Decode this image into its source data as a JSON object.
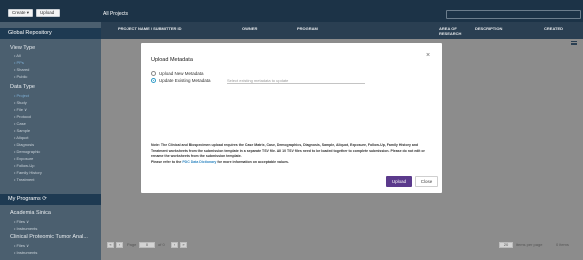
{
  "topbar": {
    "create_label": "Create ▾",
    "upload_label": "Upload ▾",
    "breadcrumb": "All Projects",
    "search_placeholder": ""
  },
  "sidebar": {
    "repository_title": "Global Repository",
    "view_type": {
      "title": "View Type",
      "items": [
        "• All",
        "• PPs",
        "• Shared",
        "• Public"
      ]
    },
    "data_type": {
      "title": "Data Type",
      "items": [
        "• Project",
        "• Study",
        "• File  ∨",
        "• Protocol",
        "• Case",
        "• Sample",
        "• Aliquot",
        "• Diagnosis",
        "• Demographic",
        "• Exposure",
        "• Follow-Up",
        "• Family History",
        "• Treatment"
      ]
    },
    "programs_title": "My Programs ⟳",
    "programs": [
      {
        "name": "Academia Sinica",
        "items": [
          "• Files  ∨",
          "• Instruments"
        ]
      },
      {
        "name": "Clinical Proteomic Tumor Anal...",
        "items": [
          "• Files  ∨",
          "• Instruments"
        ]
      }
    ]
  },
  "table": {
    "columns": [
      "PROJECT NAME / SUBMITTER ID",
      "OWNER",
      "PROGRAM",
      "AREA OF RESEARCH",
      "DESCRIPTION",
      "CREATED"
    ],
    "pager": {
      "first": "«",
      "prev": "‹",
      "page_label": "Page",
      "page_value": "0",
      "of_label": "of 0",
      "next": "›",
      "last": "»",
      "per_page_value": "20",
      "per_page_label": "items per page",
      "items_count": "0 items"
    }
  },
  "modal": {
    "title": "Upload Metadata",
    "close_glyph": "×",
    "option_new": "Upload New Metadata",
    "option_existing": "Update Existing Metadata",
    "select_placeholder": "Select existing metadata to update",
    "note_main": "Note: The Clinical and Biospecimen upload requires the Case Matrix, Case, Demographics, Diagnosis, Sample, Aliquot, Exposure, Follow-Up, Family History and Treatment worksheets from the submission template in a separate TSV file. All 10 TSV files need to be loaded together to complete submission. Please do not edit or rename the worksheets from the submission template.",
    "note_ref_prefix": "Please refer to the",
    "note_link": "PDC Data Dictionary",
    "note_ref_suffix": "for more information on acceptable values.",
    "upload_label": "Upload",
    "close_label": "Close"
  },
  "colors": {
    "topbar": "#1c3347",
    "sidebar": "#4b5f6f",
    "sidebar_header": "#1e3a52",
    "upload_button": "#5b3a8c",
    "link": "#2e86c1"
  }
}
